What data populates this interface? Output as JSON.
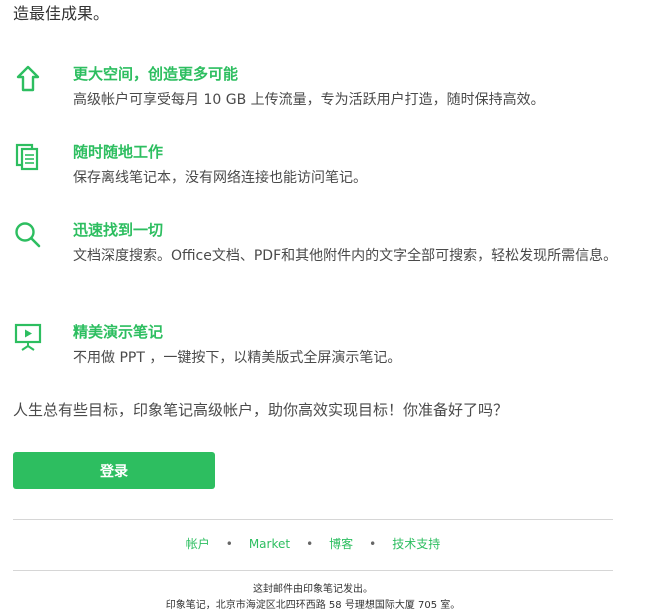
{
  "intro_text": "造最佳成果。",
  "features": [
    {
      "title": "更大空间，创造更多可能",
      "desc": "高级帐户可享受每月 10 GB 上传流量，专为活跃用户打造，随时保持高效。"
    },
    {
      "title": "随时随地工作",
      "desc": "保存离线笔记本，没有网络连接也能访问笔记。"
    },
    {
      "title": "迅速找到一切",
      "desc": "文档深度搜索。Office文档、PDF和其他附件内的文字全部可搜索，轻松发现所需信息。"
    },
    {
      "title": "精美演示笔记",
      "desc": "不用做 PPT ，一键按下，以精美版式全屏演示笔记。"
    }
  ],
  "closing_text": "人生总有些目标，印象笔记高级帐户，助你高效实现目标！你准备好了吗？",
  "login_button": "登录",
  "footer": {
    "links": [
      "帐户",
      "Market",
      "博客",
      "技术支持"
    ],
    "separator": "•",
    "line1": "这封邮件由印象笔记发出。",
    "line2": "印象笔记，北京市海淀区北四环西路 58 号理想国际大厦 705 室。"
  },
  "colors": {
    "accent": "#2dbe60",
    "text": "#4a4a4a"
  },
  "icons": [
    "upload-arrow-icon",
    "offline-notebook-icon",
    "search-icon",
    "presentation-icon"
  ]
}
